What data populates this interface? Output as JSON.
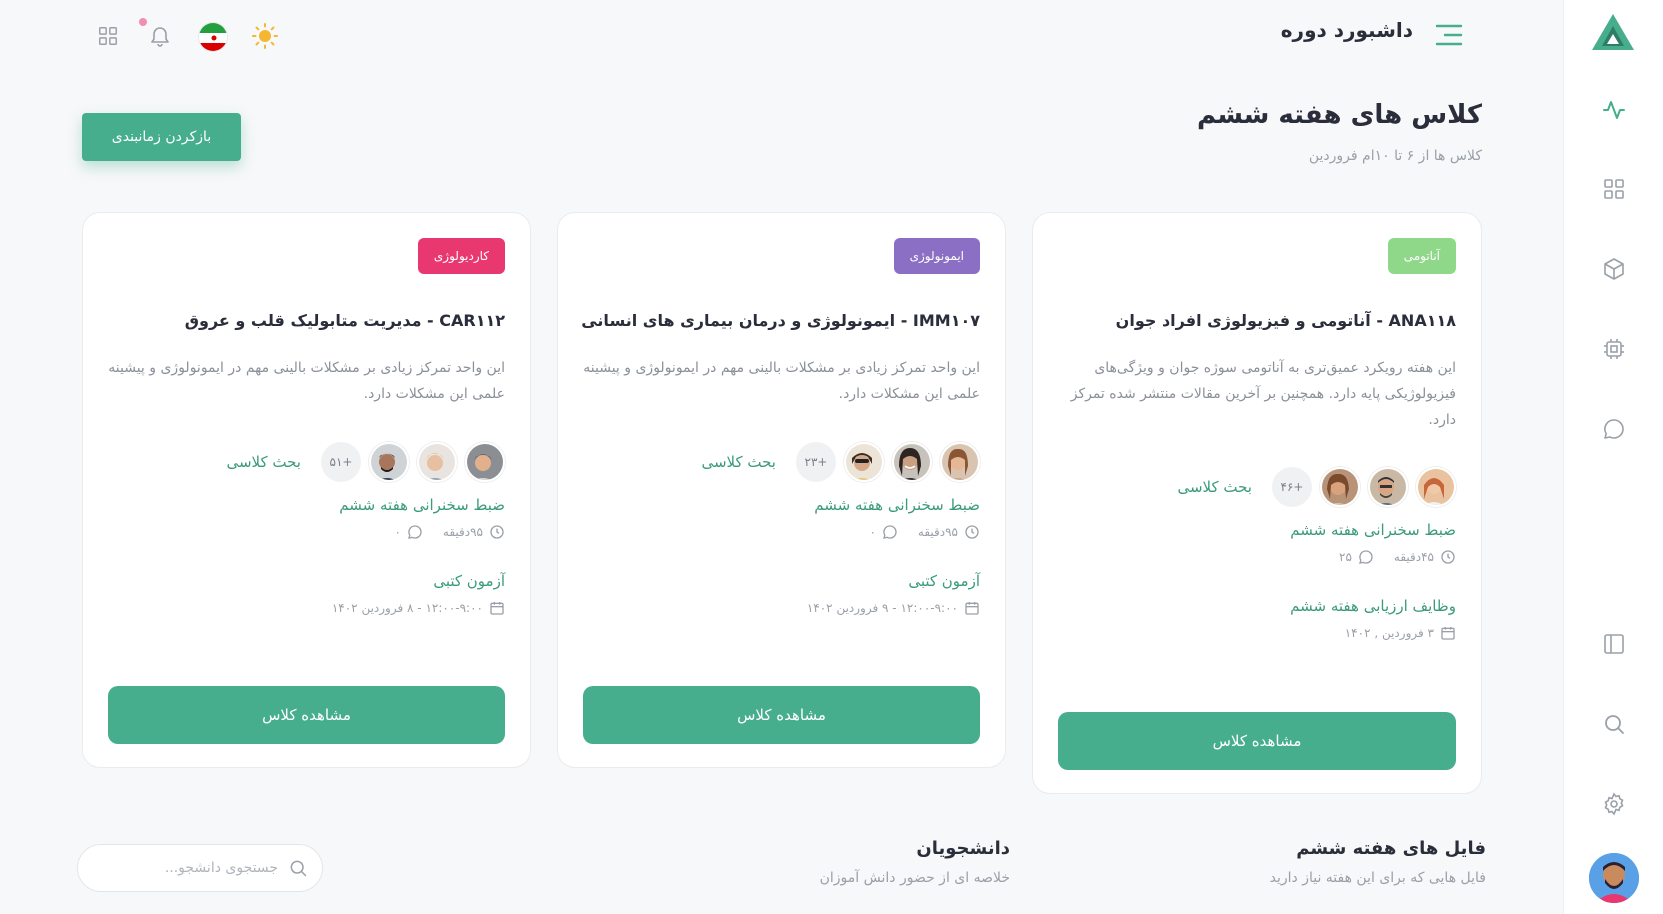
{
  "header": {
    "title": "داشبورد دوره"
  },
  "week": {
    "title": "کلاس های هفته ششم",
    "subtitle": "کلاس ها از ۶ تا ۱۰ام فروردین",
    "reset_button": "بازکردن زمانبندی"
  },
  "colors": {
    "accent": "#46ae8d",
    "accent_text": "#3a9b78",
    "badge_anatomy": "#8fd88a",
    "badge_immunology": "#8a6fc4",
    "badge_cardiology": "#e8386f"
  },
  "cards": [
    {
      "badge": "آناتومی",
      "title": "ANA۱۱۸ - آناتومی و فیزیولوژی افراد جوان",
      "description": "این هفته رویکرد عمیق‌تری به آناتومی سوژه جوان و ویژگی‌های فیزیولوژیکی پایه دارد. همچنین بر آخرین مقالات منتشر شده تمرکز دارد.",
      "participants_count": "+۴۶",
      "discussion_label": "بحث کلاسی",
      "item1_title": "ضبط سخنرانی هفته ششم",
      "item1_duration": "۴۵دقیقه",
      "item1_comments": "۲۵",
      "item2_title": "وظایف ارزیابی هفته ششم",
      "item2_date": "۳ فروردین , ۱۴۰۲",
      "button": "مشاهده کلاس"
    },
    {
      "badge": "ایمونولوژی",
      "title": "IMM۱۰۷ - ایمونولوژی و درمان بیماری های انسانی",
      "description": "این واحد تمرکز زیادی بر مشکلات بالینی مهم در ایمونولوژی و پیشینه علمی این مشکلات دارد.",
      "participants_count": "+۲۳",
      "discussion_label": "بحث کلاسی",
      "item1_title": "ضبط سخنرانی هفته ششم",
      "item1_duration": "۹۵دقیقه",
      "item1_comments": "۰",
      "item2_title": "آزمون کتبی",
      "item2_date": "۱۲:۰۰-۹:۰۰ - ۹ فروردین ۱۴۰۲",
      "button": "مشاهده کلاس"
    },
    {
      "badge": "کاردیولوژی",
      "title": "CAR۱۱۲ - مدیریت متابولیک قلب و عروق",
      "description": "این واحد تمرکز زیادی بر مشکلات بالینی مهم در ایمونولوژی و پیشینه علمی این مشکلات دارد.",
      "participants_count": "+۵۱",
      "discussion_label": "بحث کلاسی",
      "item1_title": "ضبط سخنرانی هفته ششم",
      "item1_duration": "۹۵دقیقه",
      "item1_comments": "۰",
      "item2_title": "آزمون کتبی",
      "item2_date": "۱۲:۰۰-۹:۰۰ - ۸ فروردین ۱۴۰۲",
      "button": "مشاهده کلاس"
    }
  ],
  "files": {
    "title": "فایل های هفته ششم",
    "subtitle": "فایل هایی که برای این هفته نیاز دارید"
  },
  "students": {
    "title": "دانشجویان",
    "subtitle": "خلاصه ای از حضور دانش آموزان",
    "search_placeholder": "جستجوی دانشجو..."
  }
}
